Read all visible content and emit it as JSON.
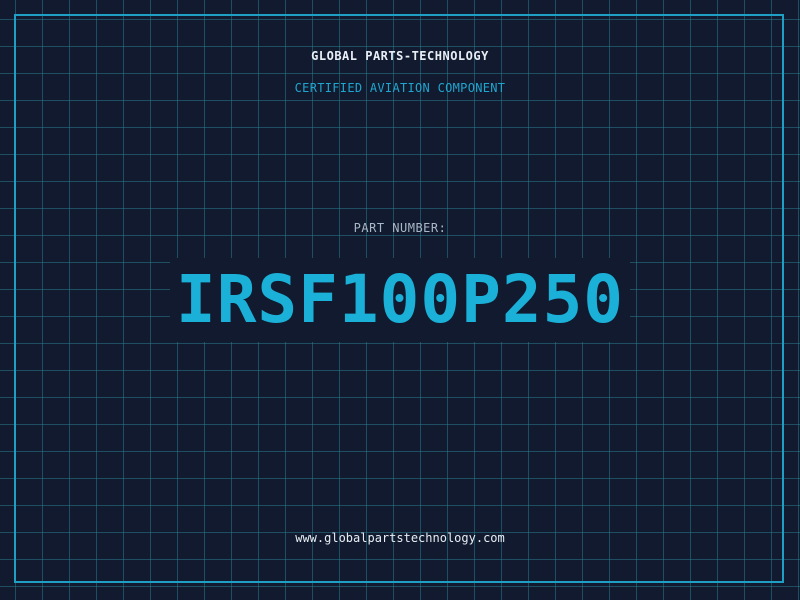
{
  "header": {
    "company": "GLOBAL PARTS-TECHNOLOGY",
    "subtitle": "CERTIFIED AVIATION COMPONENT"
  },
  "part": {
    "label": "PART NUMBER:",
    "number": "IRSF100P250"
  },
  "footer": {
    "website": "www.globalpartstechnology.com"
  },
  "colors": {
    "background": "#111a2e",
    "grid": "#28788c",
    "frame": "#1f9fc4",
    "accent": "#1ab0d8"
  }
}
